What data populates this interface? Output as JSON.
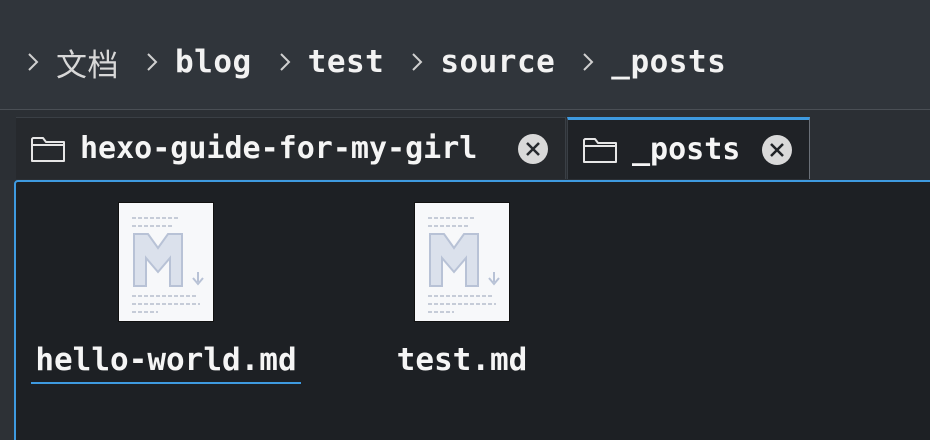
{
  "breadcrumb": {
    "items": [
      {
        "label": "文档"
      },
      {
        "label": "blog"
      },
      {
        "label": "test"
      },
      {
        "label": "source"
      },
      {
        "label": "_posts"
      }
    ]
  },
  "tabs": [
    {
      "label": "hexo-guide-for-my-girl",
      "icon": "folder-icon",
      "close_icon": "close-icon",
      "active": false
    },
    {
      "label": "_posts",
      "icon": "folder-icon",
      "close_icon": "close-icon",
      "active": true
    }
  ],
  "files": [
    {
      "name": "hello-world.md",
      "icon": "markdown-file-icon",
      "selected": true
    },
    {
      "name": "test.md",
      "icon": "markdown-file-icon",
      "selected": false
    }
  ],
  "colors": {
    "accent": "#3e9ae0",
    "background": "#1d2024",
    "toolbar": "#30353b"
  }
}
